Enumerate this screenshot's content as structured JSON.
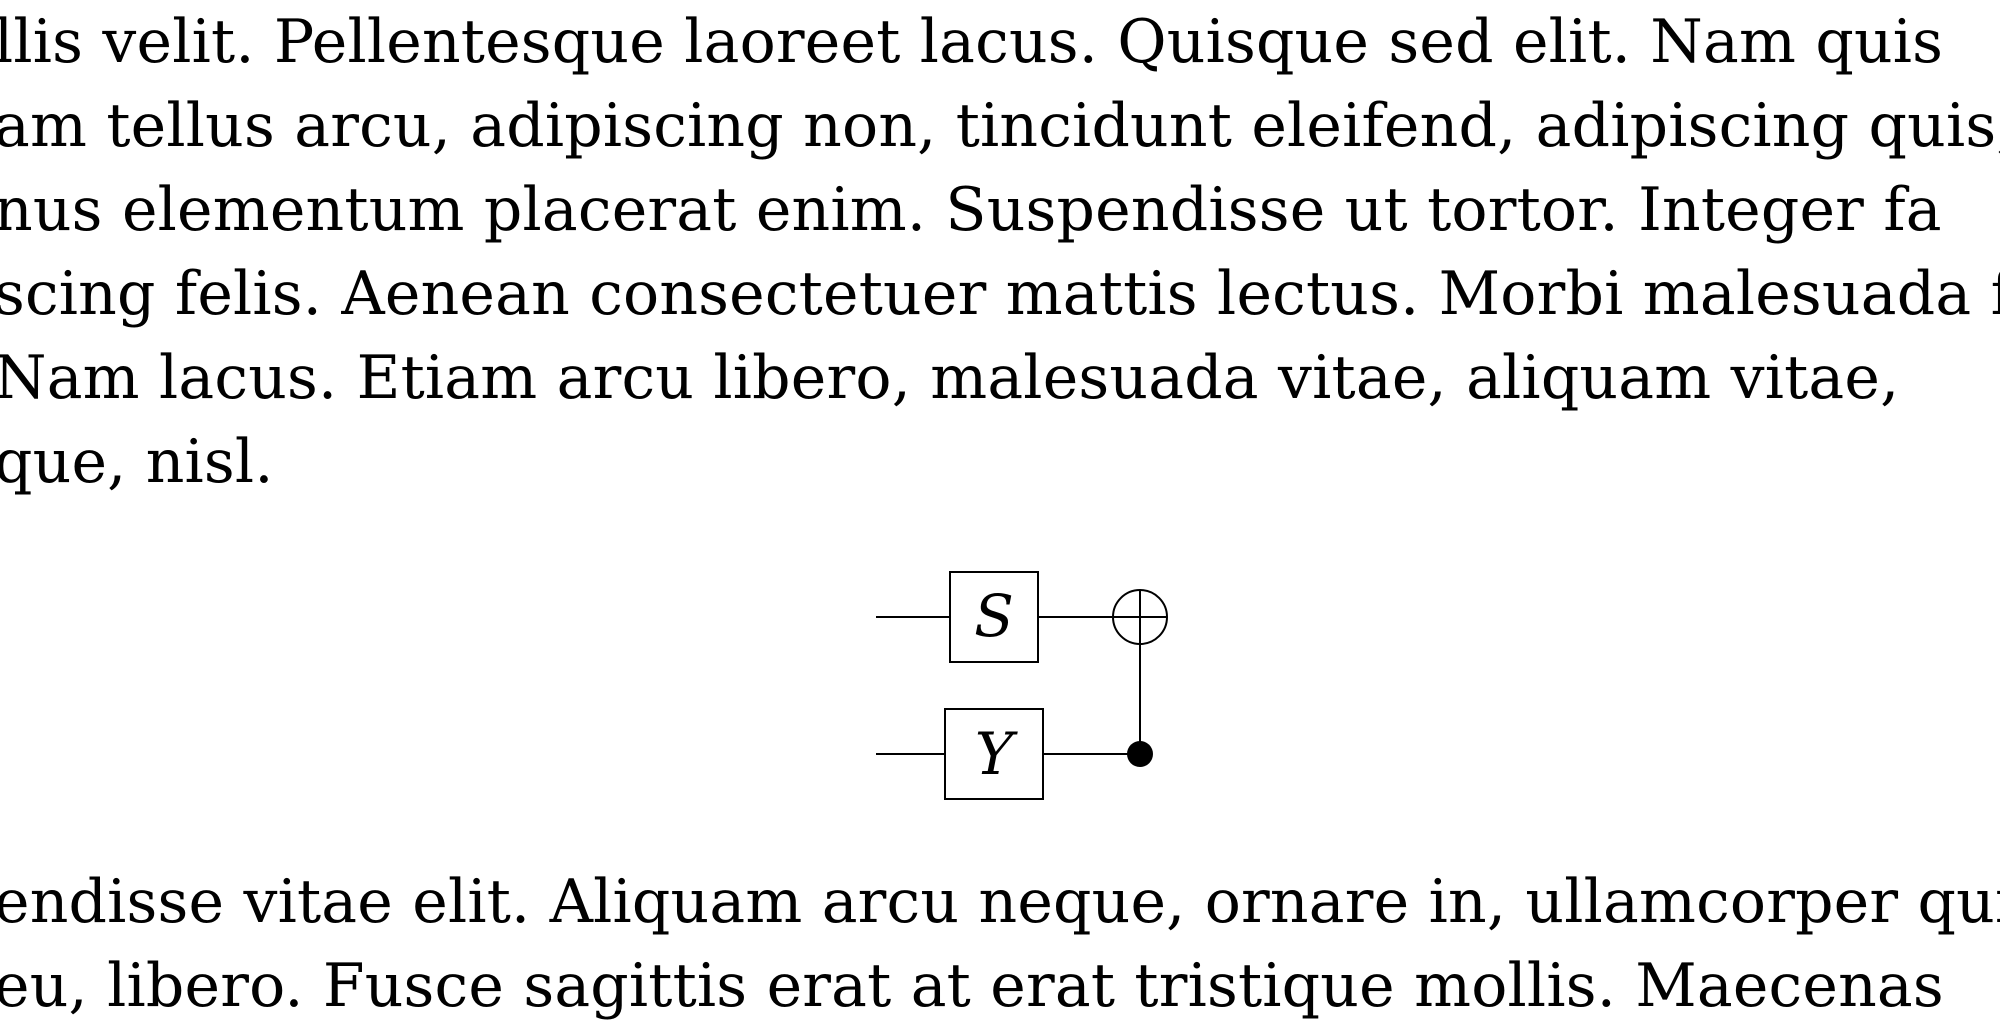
{
  "paragraph_top": {
    "lines": [
      "llis velit.  Pellentesque laoreet lacus.  Quisque sed elit.  Nam quis",
      "am tellus arcu, adipiscing non, tincidunt eleifend, adipiscing quis,",
      "nus elementum placerat enim.  Suspendisse ut tortor.  Integer fa",
      "scing felis.  Aenean consectetuer mattis lectus.  Morbi malesuada fa",
      "  Nam lacus.  Etiam arcu libero, malesuada vitae, aliquam vitae,",
      "que, nisl."
    ]
  },
  "circuit": {
    "gates": [
      {
        "label": "S"
      },
      {
        "label": "Y"
      }
    ]
  },
  "paragraph_bottom": {
    "lines": [
      "endisse vitae elit.  Aliquam arcu neque, ornare in, ullamcorper qui",
      "  eu, libero.  Fusce sagittis erat at erat tristique mollis.  Maecenas"
    ]
  }
}
